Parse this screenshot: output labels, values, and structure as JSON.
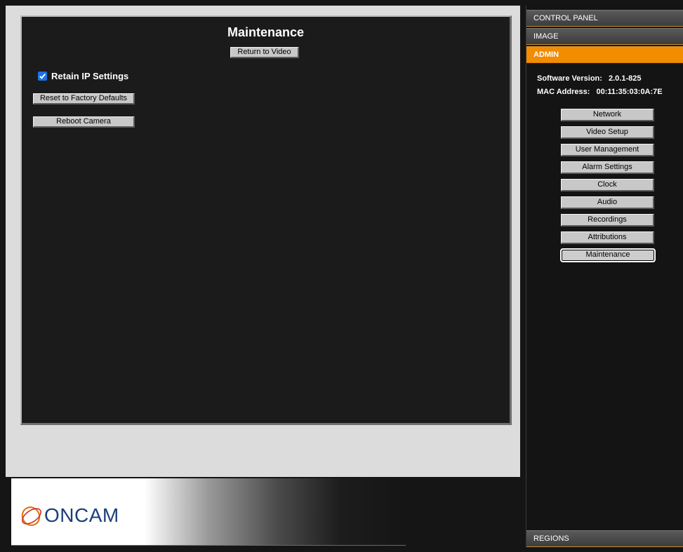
{
  "main": {
    "title": "Maintenance",
    "return_label": "Return to Video",
    "retain_label": "Retain IP Settings",
    "retain_checked": true,
    "reset_label": "Reset to Factory Defaults",
    "reboot_label": "Reboot Camera"
  },
  "logo": {
    "text": "ONCAM",
    "brand_color": "#1d3f7a",
    "swoosh_color": "#e07a1a"
  },
  "sidebar": {
    "headers": {
      "control_panel": "CONTROL PANEL",
      "image": "IMAGE",
      "admin": "ADMIN",
      "regions": "REGIONS"
    },
    "software_version_label": "Software Version:",
    "software_version_value": "2.0.1-825",
    "mac_label": "MAC Address:",
    "mac_value": "00:11:35:03:0A:7E",
    "nav_items": [
      "Network",
      "Video Setup",
      "User Management",
      "Alarm Settings",
      "Clock",
      "Audio",
      "Recordings",
      "Attributions",
      "Maintenance"
    ],
    "selected_item": "Maintenance",
    "accent_color": "#f28c00"
  }
}
